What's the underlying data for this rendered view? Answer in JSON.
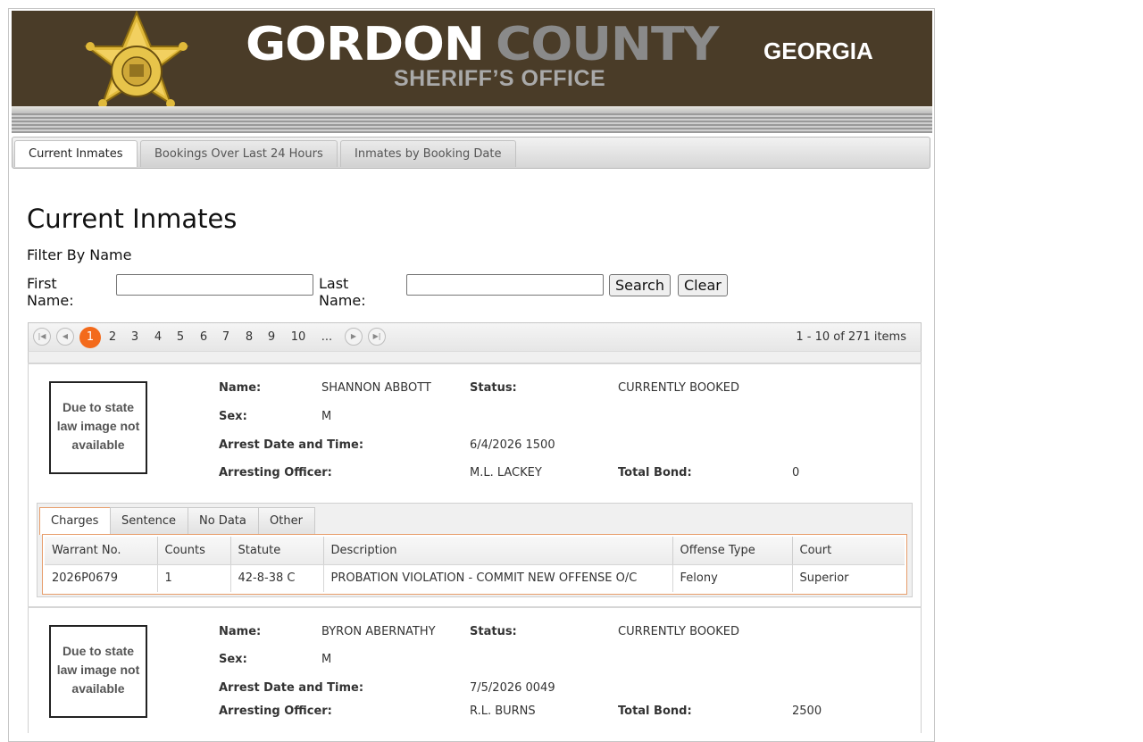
{
  "header": {
    "title_part1": "GORDON",
    "title_part2": "COUNTY",
    "subtitle": "SHERIFF’S OFFICE",
    "state": "GEORGIA",
    "badge_text_top": "SHERIFF'S OFFICE",
    "badge_text_bottom": "GORDON COUNTY"
  },
  "nav": {
    "tabs": [
      {
        "label": "Current Inmates",
        "active": true
      },
      {
        "label": "Bookings Over Last 24 Hours",
        "active": false
      },
      {
        "label": "Inmates by Booking Date",
        "active": false
      }
    ]
  },
  "main": {
    "heading": "Current Inmates",
    "filter_label": "Filter By Name",
    "first_name_label": "First Name:",
    "first_name_value": "",
    "last_name_label": "Last Name:",
    "last_name_value": "",
    "search_label": "Search",
    "clear_label": "Clear"
  },
  "pager": {
    "pages": [
      "1",
      "2",
      "3",
      "4",
      "5",
      "6",
      "7",
      "8",
      "9",
      "10",
      "..."
    ],
    "current_page": "1",
    "info": "1 - 10 of 271 items"
  },
  "labels": {
    "name": "Name:",
    "status": "Status:",
    "sex": "Sex:",
    "arrest": "Arrest Date and Time:",
    "officer": "Arresting Officer:",
    "bond": "Total Bond:",
    "photo_placeholder": "Due to state law image not available"
  },
  "detail_tabs": [
    "Charges",
    "Sentence",
    "No Data",
    "Other"
  ],
  "charge_columns": [
    "Warrant No.",
    "Counts",
    "Statute",
    "Description",
    "Offense Type",
    "Court"
  ],
  "inmates": [
    {
      "name": "SHANNON ABBOTT",
      "status": "CURRENTLY BOOKED",
      "sex": "M",
      "arrest_datetime": "6/4/2026 1500",
      "arresting_officer": "M.L. LACKEY",
      "total_bond": "0",
      "charges": [
        {
          "warrant": "2026P0679",
          "counts": "1",
          "statute": "42-8-38 C",
          "description": "PROBATION VIOLATION - COMMIT NEW OFFENSE O/C",
          "offense_type": "Felony",
          "court": "Superior"
        }
      ]
    },
    {
      "name": "BYRON ABERNATHY",
      "status": "CURRENTLY BOOKED",
      "sex": "M",
      "arrest_datetime": "7/5/2026 0049",
      "arresting_officer": "R.L. BURNS",
      "total_bond": "2500"
    }
  ]
}
